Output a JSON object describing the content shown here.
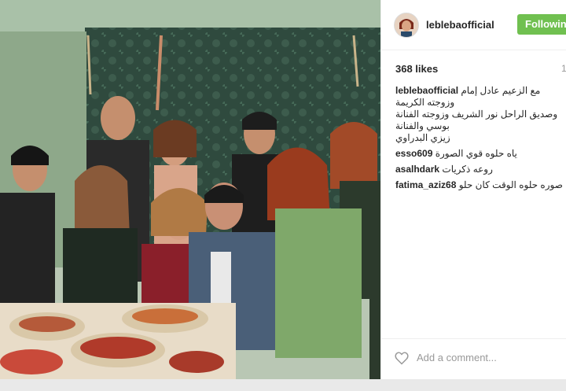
{
  "post": {
    "username": "leblebaofficial",
    "follow_label": "Following",
    "likes": "368 likes",
    "timestamp": "1",
    "caption": {
      "user": "leblebaofficial",
      "line1": "مع الزعيم عادل إمام وزوجته الكريمة",
      "line2": "وصديق الراحل نور الشريف وزوجته الفنانة بوسي والفنانة",
      "line3": "زيزي البدراوي"
    },
    "comments": [
      {
        "user": "esso609",
        "text": "ياه حلوه قوي الصورة"
      },
      {
        "user": "asalhdark",
        "text": "روعه ذكريات"
      },
      {
        "user": "fatima_aziz68",
        "text": "صوره حلوه الوقت كان حلو"
      }
    ],
    "add_comment_placeholder": "Add a comment..."
  },
  "colors": {
    "follow_green": "#70c050",
    "text_dark": "#262626",
    "muted": "#999999"
  },
  "icons": {
    "heart": "heart-outline-icon",
    "avatar": "profile-avatar"
  }
}
